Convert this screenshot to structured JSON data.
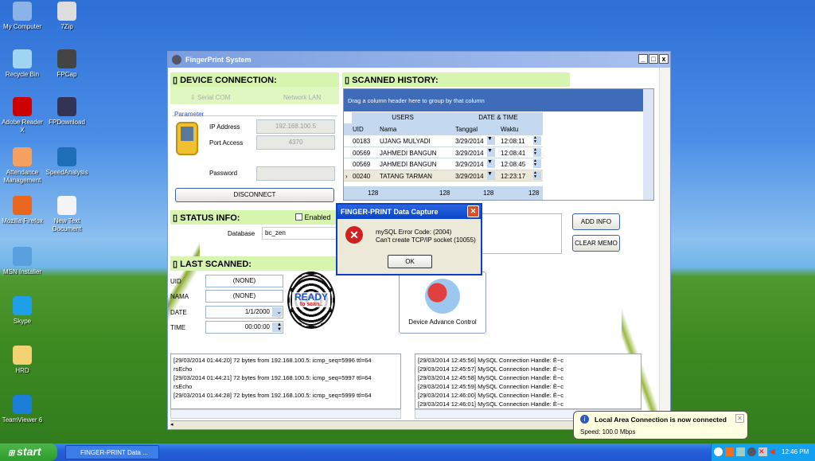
{
  "desktop": {
    "icons": [
      {
        "label": "My Computer",
        "color": "#8ab4e8"
      },
      {
        "label": "7Zip",
        "color": "#ddd"
      },
      {
        "label": "Recycle Bin",
        "color": "#9fd4f2"
      },
      {
        "label": "FPCap",
        "color": "#444"
      },
      {
        "label": "Adobe Reader X",
        "color": "#c00"
      },
      {
        "label": "FPDownload",
        "color": "#335"
      },
      {
        "label": "Attendance Management",
        "color": "#f4a060"
      },
      {
        "label": "SpeedAnalysis",
        "color": "#1e6fb8"
      },
      {
        "label": "Mozilla Firefox",
        "color": "#e8661e"
      },
      {
        "label": "New Text Document",
        "color": "#f4f4f4"
      },
      {
        "label": "MSN Installer",
        "color": "#5aa0e0"
      },
      {
        "label": "Skype",
        "color": "#1ea0e8"
      },
      {
        "label": "HRD",
        "color": "#f2d272"
      },
      {
        "label": "TeamViewer 6",
        "color": "#1b7fd8"
      }
    ]
  },
  "window": {
    "title": "FingerPrint System",
    "device": {
      "header": "DEVICE CONNECTION:",
      "tabs": [
        "Serial COM",
        "Network LAN"
      ],
      "group": "Parameter",
      "ip_label": "IP Address",
      "ip": "192.168.100.5",
      "port_label": "Port Access",
      "port": "4370",
      "password_label": "Password",
      "password": "",
      "button": "DISCONNECT"
    },
    "history": {
      "header": "SCANNED HISTORY:",
      "group_hint": "Drag a column header here to group by that column",
      "bands": [
        "USERS",
        "DATE & TIME"
      ],
      "columns": [
        "UID",
        "Nama",
        "Tanggal",
        "Waktu"
      ],
      "rows": [
        [
          "00183",
          "UJANG MULYADI",
          "3/29/2014",
          "12:08:11"
        ],
        [
          "00569",
          "JAHMEDI BANGUN",
          "3/29/2014",
          "12:08:41"
        ],
        [
          "00569",
          "JAHMEDI BANGUN",
          "3/29/2014",
          "12:08:45"
        ],
        [
          "00240",
          "TATANG TARMAN",
          "3/29/2014",
          "12:23:17"
        ]
      ],
      "footer": [
        "128",
        "128",
        "128",
        "128"
      ]
    },
    "status": {
      "header": "STATUS INFO:",
      "enabled_label": "Enabled",
      "enabled": false,
      "database_label": "Database",
      "database": "bc_zen"
    },
    "memo": {
      "add_info": "ADD INFO",
      "clear_memo": "CLEAR MEMO"
    },
    "last": {
      "header": "LAST SCANNED:",
      "uid_label": "UID",
      "uid": "(NONE)",
      "nama_label": "NAMA",
      "nama": "(NONE)",
      "date_label": "DATE",
      "date": "1/1/2000",
      "time_label": "TIME",
      "time": "00:00:00",
      "logo_main": "READY",
      "logo_sub": "to scan..",
      "device_button": "Device Advance Control"
    },
    "log_left": [
      "[29/03/2014 01:44:20] 72 bytes from 192.168.100.5: icmp_seq=5996 ttl=64",
      "rsEcho",
      "[29/03/2014 01:44:21] 72 bytes from 192.168.100.5: icmp_seq=5997 ttl=64",
      "rsEcho",
      "[29/03/2014 01:44:28] 72 bytes from 192.168.100.5: icmp_seq=5999 ttl=64"
    ],
    "log_right": [
      "[29/03/2014 12:45:56] MySQL Connection Handle: È~c",
      "[29/03/2014 12:45:57] MySQL Connection Handle: È~c",
      "[29/03/2014 12:45:58] MySQL Connection Handle: È~c",
      "[29/03/2014 12:45:59] MySQL Connection Handle: È~c",
      "[29/03/2014 12:46:00] MySQL Connection Handle: È~c",
      "[29/03/2014 12:46:01] MySQL Connection Handle: È~c"
    ]
  },
  "dialog": {
    "title": "FINGER-PRINT Data Capture",
    "line1": "mySQL Error Code: (2004)",
    "line2": "Can't create TCP/IP socket (10055)",
    "ok": "OK"
  },
  "balloon": {
    "title": "Local Area Connection is now connected",
    "text": "Speed: 100.0 Mbps"
  },
  "taskbar": {
    "start": "start",
    "task": "FINGER-PRINT Data ...",
    "clock": "12:46 PM"
  }
}
